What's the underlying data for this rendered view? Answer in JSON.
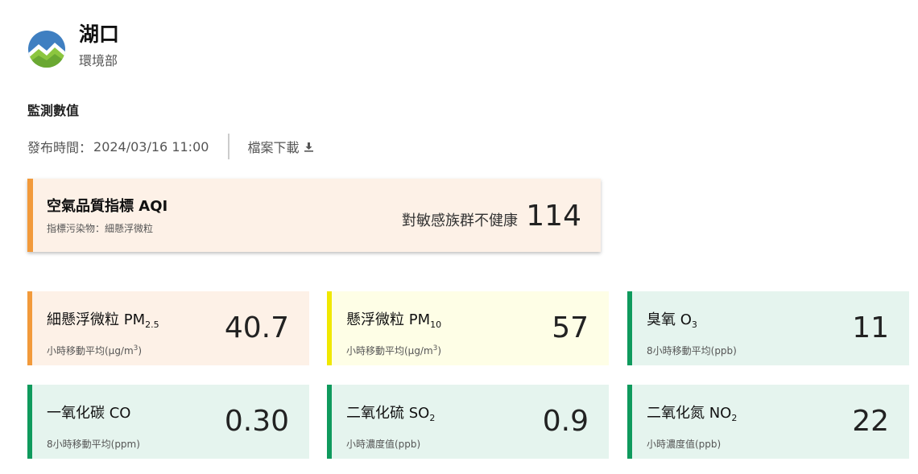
{
  "header": {
    "station_name": "湖口",
    "org_name": "環境部",
    "logo_icon": "moenv-logo"
  },
  "section_title": "監測數值",
  "publish": {
    "label": "發布時間：",
    "time": "2024/03/16 11:00",
    "download_label": "檔案下載",
    "download_icon": "download-icon"
  },
  "aqi": {
    "title": "空氣品質指標 AQI",
    "subtitle": "指標污染物：細懸浮微粒",
    "status": "對敏感族群不健康",
    "value": "114",
    "color": "#f29a3b"
  },
  "cards": [
    {
      "name": "細懸浮微粒 PM",
      "sub": "2.5",
      "unit": "小時移動平均(μg/m",
      "unit_sup": "3",
      "unit_end": ")",
      "value": "40.7",
      "color": "#f29a3b"
    },
    {
      "name": "懸浮微粒 PM",
      "sub": "10",
      "unit": "小時移動平均(μg/m",
      "unit_sup": "3",
      "unit_end": ")",
      "value": "57",
      "color": "#f0e800"
    },
    {
      "name": "臭氧 O",
      "sub": "3",
      "unit": "8小時移動平均(ppb)",
      "value": "11",
      "color": "#0f9a5d"
    },
    {
      "name": "一氧化碳 CO",
      "unit": "8小時移動平均(ppm)",
      "value": "0.30",
      "color": "#0f9a5d"
    },
    {
      "name": "二氧化硫 SO",
      "sub": "2",
      "unit": "小時濃度值(ppb)",
      "value": "0.9",
      "color": "#0f9a5d"
    },
    {
      "name": "二氧化氮 NO",
      "sub": "2",
      "unit": "小時濃度值(ppb)",
      "value": "22",
      "color": "#0f9a5d"
    }
  ]
}
